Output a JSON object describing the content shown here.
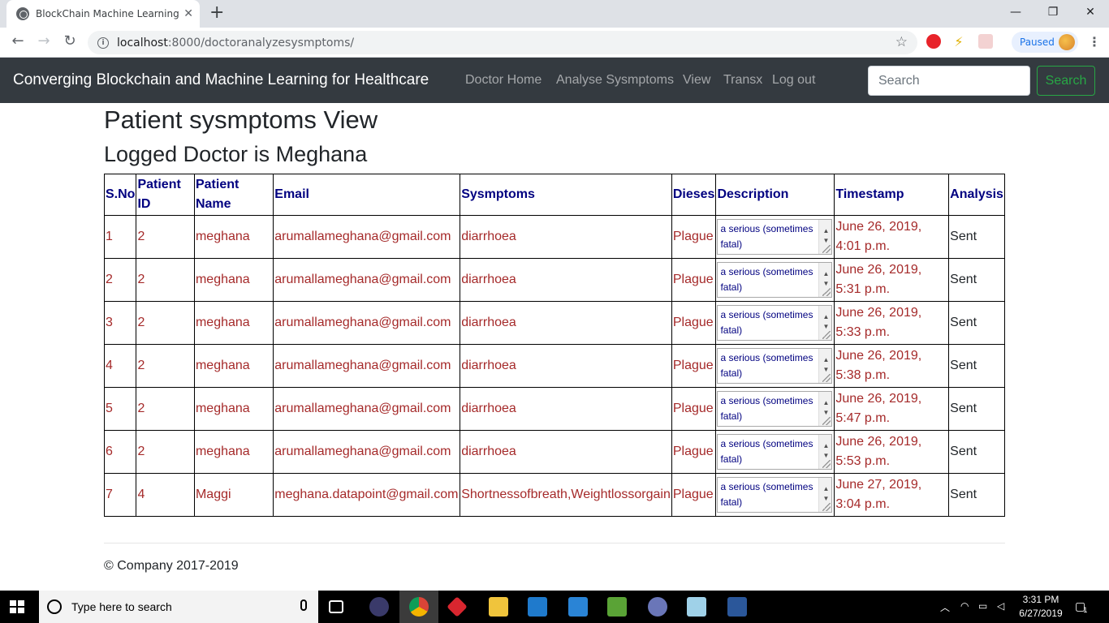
{
  "browser": {
    "tab_title": "BlockChain Machine Learning · B",
    "tab_close": "✕",
    "new_tab": "+",
    "url_host": "localhost",
    "url_path": ":8000/doctoranalyzesysmptoms/",
    "profile_status": "Paused",
    "window_minimize": "—",
    "window_restore": "❐",
    "window_close": "✕"
  },
  "navbar": {
    "brand": "Converging Blockchain and Machine Learning for Healthcare",
    "links": [
      "Doctor Home",
      "Analyse Sysmptoms",
      "View",
      "Transx",
      "Log out"
    ],
    "search_placeholder": "Search",
    "search_button": "Search"
  },
  "page": {
    "title": "Patient sysmptoms View",
    "subtitle": "Logged Doctor is Meghana"
  },
  "table": {
    "headers": [
      "S.No",
      "Patient ID",
      "Patient Name",
      "Email",
      "Sysmptoms",
      "Dieses",
      "Description",
      "Timestamp",
      "Analysis"
    ],
    "rows": [
      {
        "sno": "1",
        "pid": "2",
        "name": "meghana",
        "email": "arumallameghana@gmail.com",
        "symptoms": "diarrhoea",
        "disease": "Plague",
        "description": "a serious (sometimes fatal)",
        "timestamp": "June 26, 2019, 4:01 p.m.",
        "analysis": "Sent"
      },
      {
        "sno": "2",
        "pid": "2",
        "name": "meghana",
        "email": "arumallameghana@gmail.com",
        "symptoms": "diarrhoea",
        "disease": "Plague",
        "description": "a serious (sometimes fatal)",
        "timestamp": "June 26, 2019, 5:31 p.m.",
        "analysis": "Sent"
      },
      {
        "sno": "3",
        "pid": "2",
        "name": "meghana",
        "email": "arumallameghana@gmail.com",
        "symptoms": "diarrhoea",
        "disease": "Plague",
        "description": "a serious (sometimes fatal)",
        "timestamp": "June 26, 2019, 5:33 p.m.",
        "analysis": "Sent"
      },
      {
        "sno": "4",
        "pid": "2",
        "name": "meghana",
        "email": "arumallameghana@gmail.com",
        "symptoms": "diarrhoea",
        "disease": "Plague",
        "description": "a serious (sometimes fatal)",
        "timestamp": "June 26, 2019, 5:38 p.m.",
        "analysis": "Sent"
      },
      {
        "sno": "5",
        "pid": "2",
        "name": "meghana",
        "email": "arumallameghana@gmail.com",
        "symptoms": "diarrhoea",
        "disease": "Plague",
        "description": "a serious (sometimes fatal)",
        "timestamp": "June 26, 2019, 5:47 p.m.",
        "analysis": "Sent"
      },
      {
        "sno": "6",
        "pid": "2",
        "name": "meghana",
        "email": "arumallameghana@gmail.com",
        "symptoms": "diarrhoea",
        "disease": "Plague",
        "description": "a serious (sometimes fatal)",
        "timestamp": "June 26, 2019, 5:53 p.m.",
        "analysis": "Sent"
      },
      {
        "sno": "7",
        "pid": "4",
        "name": "Maggi",
        "email": "meghana.datapoint@gmail.com",
        "symptoms": "Shortnessofbreath,Weightlossorgain",
        "disease": "Plague",
        "description": "a serious (sometimes fatal)",
        "timestamp": "June 27, 2019, 3:04 p.m.",
        "analysis": "Sent"
      }
    ]
  },
  "footer": {
    "text": "© Company 2017-2019"
  },
  "taskbar": {
    "search_placeholder": "Type here to search",
    "time": "3:31 PM",
    "date": "6/27/2019",
    "notification_count": "1"
  },
  "colors": {
    "navbar_bg": "#343a40",
    "header_text": "#000080",
    "cell_text": "#a52a2a",
    "search_button": "#28a745"
  }
}
